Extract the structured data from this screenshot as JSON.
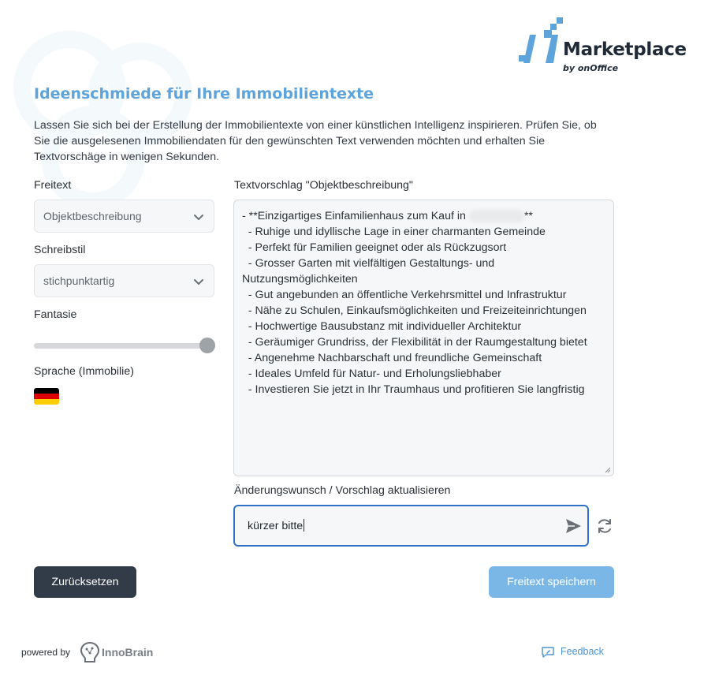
{
  "brand": {
    "name": "Marketplace",
    "sub": "by onOffice",
    "colors": {
      "blue": "#5ea3d9",
      "dark": "#1f2a36"
    }
  },
  "header": {
    "title": "Ideenschmiede für Ihre Immobilientexte",
    "intro": "Lassen Sie sich bei der Erstellung der Immobilientexte von einer künstlichen Intelligenz inspirieren. Prüfen Sie, ob Sie die ausgelesenen Immobiliendaten für den gewünschten Text verwenden möchten und erhalten Sie Textvorschäge in wenigen Sekunden."
  },
  "left": {
    "freitext_label": "Freitext",
    "freitext_value": "Objektbeschreibung",
    "schreibstil_label": "Schreibstil",
    "schreibstil_value": "stichpunktartig",
    "fantasie_label": "Fantasie",
    "fantasie_level": 1.0,
    "sprache_label": "Sprache (Immobilie)",
    "sprache_flag": "flag-de-icon"
  },
  "suggestion": {
    "label": "Textvorschlag \"Objektbeschreibung\"",
    "lines": [
      "- **Einzigartiges Einfamilienhaus zum Kauf in",
      "  - Ruhige und idyllische Lage in einer charmanten Gemeinde",
      "  - Perfekt für Familien geeignet oder als Rückzugsort",
      "  - Grosser Garten mit vielfältigen Gestaltungs- und Nutzungsmöglichkeiten",
      "  - Gut angebunden an öffentliche Verkehrsmittel und Infrastruktur",
      "  - Nähe zu Schulen, Einkaufsmöglichkeiten und Freizeiteinrichtungen",
      "  - Hochwertige Bausubstanz mit individueller Architektur",
      "  - Geräumiger Grundriss, der Flexibilität in der Raumgestaltung bietet",
      "  - Angenehme Nachbarschaft und freundliche Gemeinschaft",
      "  - Ideales Umfeld für Natur- und Erholungsliebhaber",
      "  - Investieren Sie jetzt in Ihr Traumhaus und profitieren Sie langfristig"
    ],
    "line1_suffix": "**"
  },
  "change": {
    "label": "Änderungswunsch / Vorschlag aktualisieren",
    "value": "kürzer bitte"
  },
  "buttons": {
    "reset": "Zurücksetzen",
    "save": "Freitext speichern"
  },
  "footer": {
    "powered": "powered by",
    "inno": "InnoBrain",
    "feedback": "Feedback"
  }
}
